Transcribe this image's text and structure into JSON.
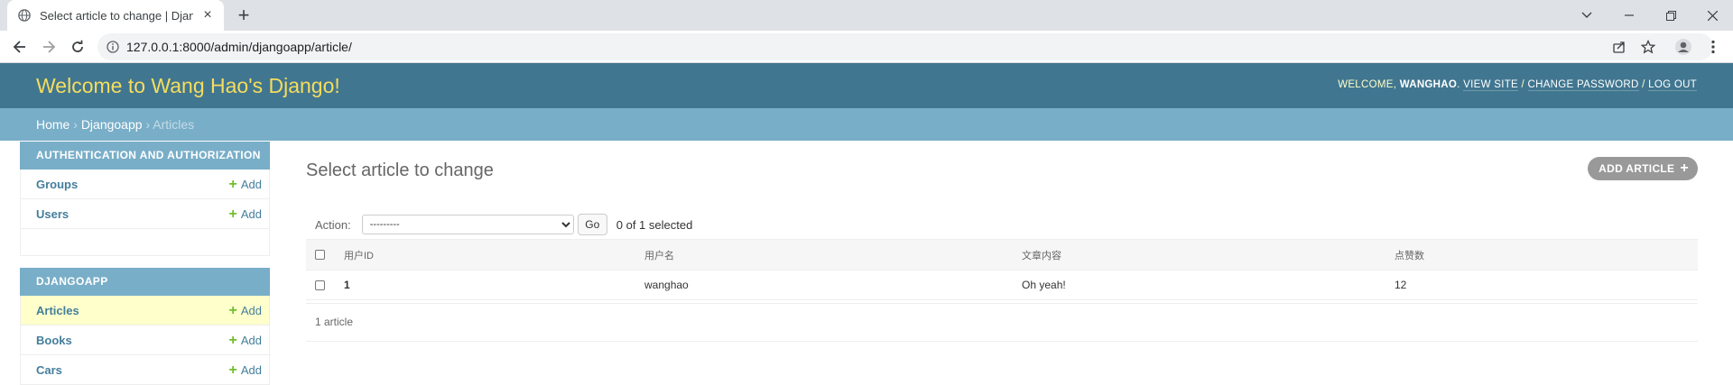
{
  "browser": {
    "tab_title": "Select article to change | Django",
    "url": "127.0.0.1:8000/admin/djangoapp/article/"
  },
  "admin": {
    "branding": "Welcome to Wang Hao's Django!",
    "welcome": "WELCOME,",
    "username": "WANGHAO",
    "view_site": "VIEW SITE",
    "change_password": "CHANGE PASSWORD",
    "log_out": "LOG OUT",
    "sep": "/",
    "dot": "."
  },
  "breadcrumbs": {
    "home": "Home",
    "app": "Djangoapp",
    "current": "Articles",
    "sep": "›"
  },
  "sidebar": {
    "auth_caption": "AUTHENTICATION AND AUTHORIZATION",
    "auth_items": [
      {
        "label": "Groups",
        "add": "Add"
      },
      {
        "label": "Users",
        "add": "Add"
      }
    ],
    "app_caption": "DJANGOAPP",
    "app_items": [
      {
        "label": "Articles",
        "add": "Add",
        "current": true
      },
      {
        "label": "Books",
        "add": "Add"
      },
      {
        "label": "Cars",
        "add": "Add"
      }
    ]
  },
  "content": {
    "title": "Select article to change",
    "add_button": "ADD ARTICLE",
    "action_label": "Action:",
    "action_select": "---------",
    "go_button": "Go",
    "selected_count": "0 of 1 selected",
    "columns": [
      "用户ID",
      "用户名",
      "文章内容",
      "点赞数"
    ],
    "rows": [
      {
        "id": "1",
        "username": "wanghao",
        "content": "Oh yeah!",
        "likes": "12"
      }
    ],
    "paginator": "1 article"
  },
  "colors": {
    "header_bg": "#417690",
    "branding": "#f5dd5d",
    "breadcrumbs_bg": "#79aec8",
    "link": "#447e9b",
    "add_plus": "#70bf2b",
    "current_row": "#ffffcc"
  }
}
